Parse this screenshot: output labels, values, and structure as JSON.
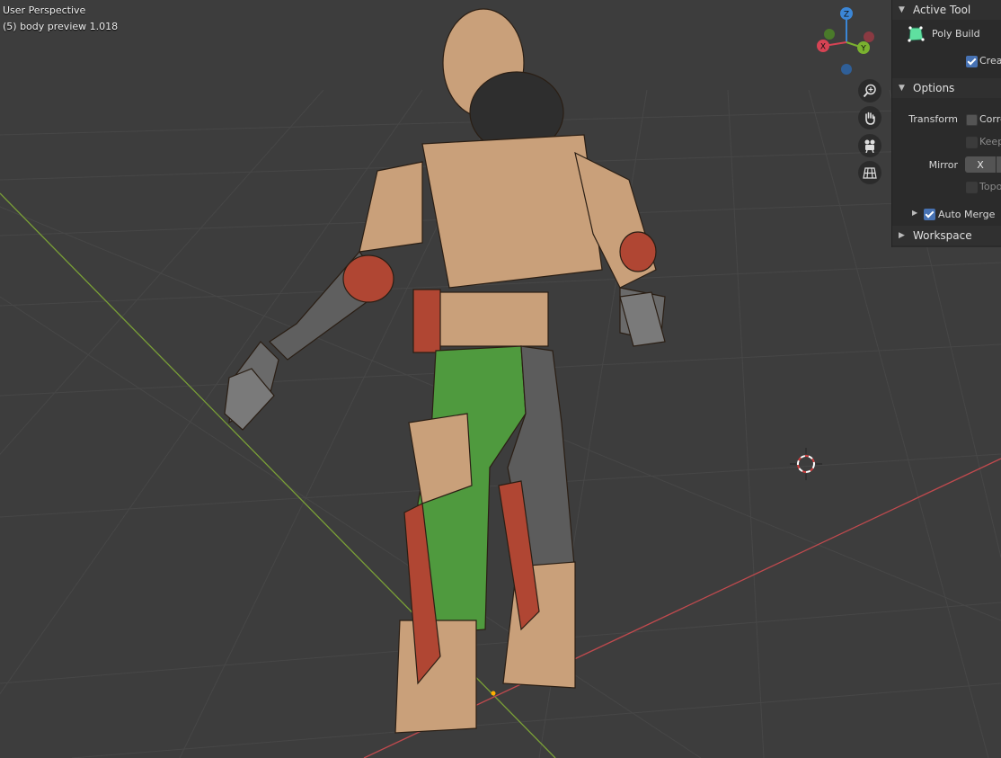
{
  "viewport": {
    "view_name": "User Perspective",
    "object_info": "(5) body preview 1.018",
    "gizmo": {
      "z": "Z",
      "y": "Y",
      "x": "X"
    },
    "nav_buttons": [
      "zoom-icon",
      "pan-hand-icon",
      "camera-icon",
      "ortho-grid-icon"
    ]
  },
  "panel": {
    "active_tool_header": "Active Tool",
    "tool_name": "Poly Build",
    "create_label": "Create",
    "options_header": "Options",
    "transform_label": "Transform",
    "correct_label": "Correct",
    "keep_label": "Keep",
    "mirror_label": "Mirror",
    "mirror_x": "X",
    "topology_label": "Topology",
    "auto_merge_label": "Auto Merge",
    "workspace_header": "Workspace"
  },
  "colors": {
    "viewport_bg": "#3d3d3d",
    "grid": "#4a4a4a",
    "x_axis": "#c04a4e",
    "y_axis": "#7aa037",
    "accent": "#4772b3",
    "mesh_body": "#c9a07a",
    "mesh_selected": "#4f9a3e"
  }
}
